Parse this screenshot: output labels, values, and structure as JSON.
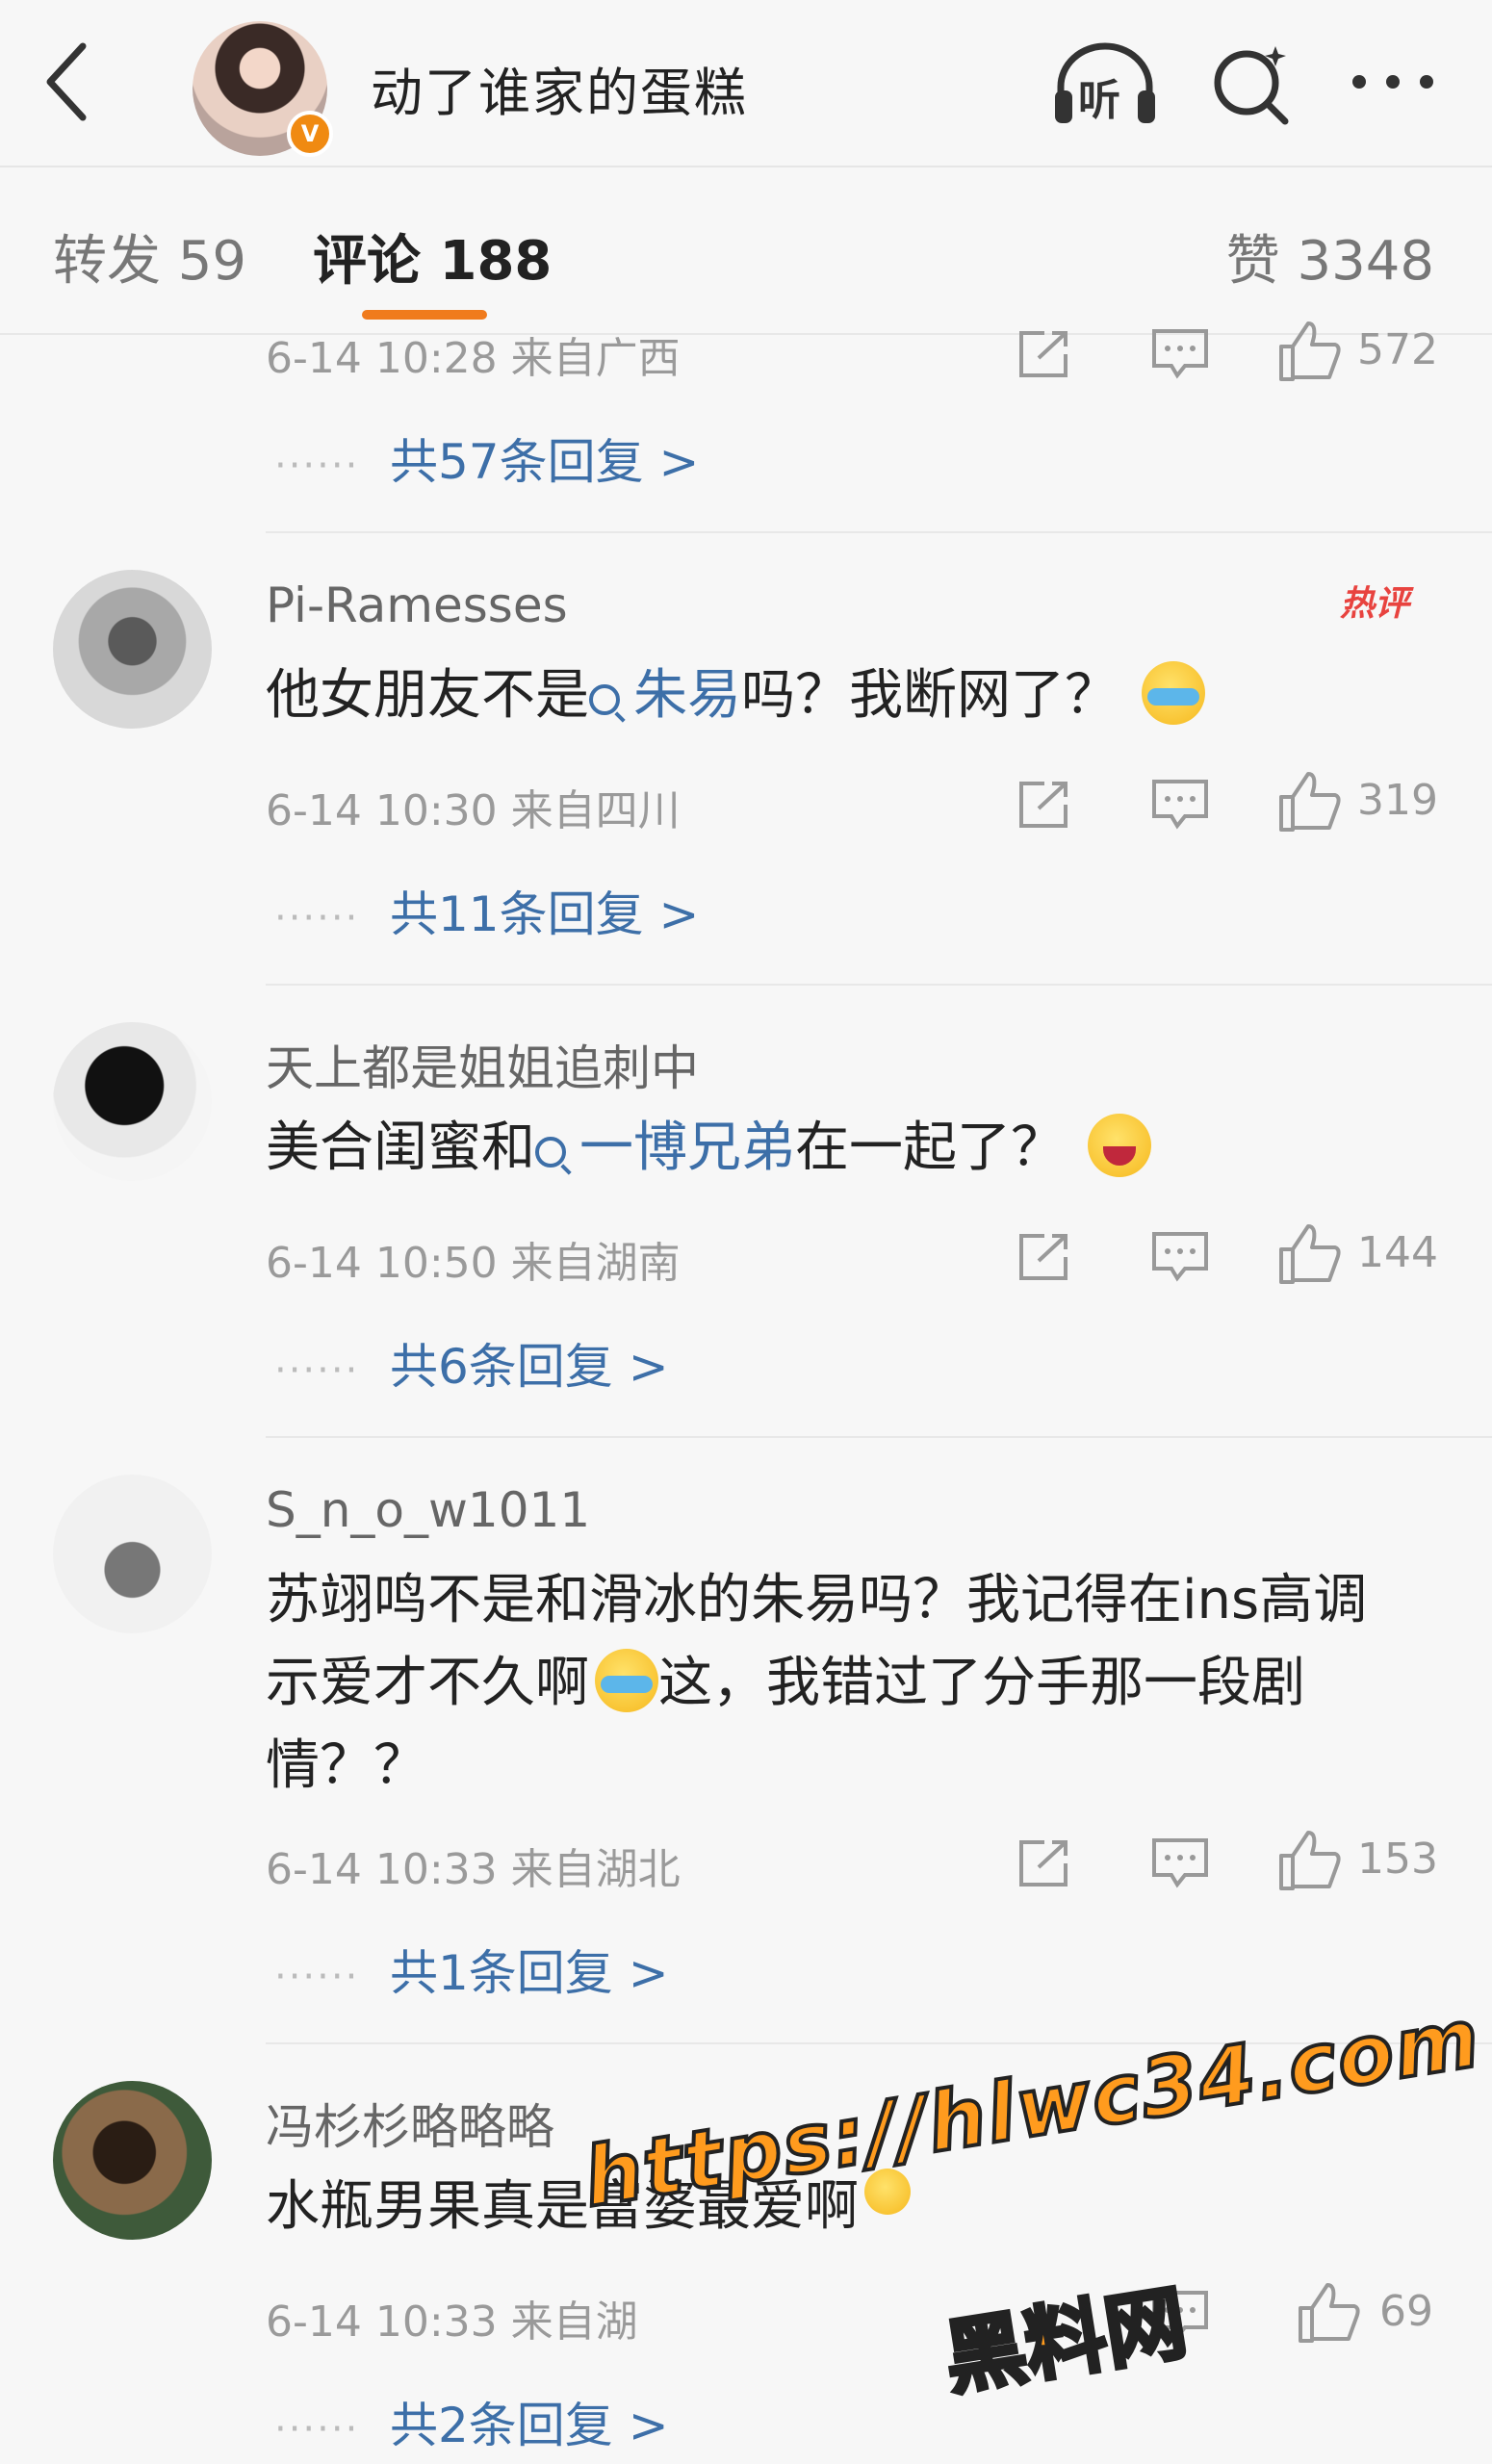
{
  "header": {
    "title": "动了谁家的蛋糕",
    "listen_label": "听",
    "badge": "V"
  },
  "tabs": {
    "repost": "转发 59",
    "comments": "评论 188",
    "likes": "赞 3348"
  },
  "top_partial": {
    "meta": "6-14 10:28 来自广西",
    "likes": "572",
    "replies": "共57条回复 >"
  },
  "comments": [
    {
      "username": "Pi-Ramesses",
      "badge": "热评",
      "text_before": "他女朋友不是",
      "topic": "朱易",
      "text_after": "吗？我断网了？",
      "meta": "6-14 10:30 来自四川",
      "likes": "319",
      "replies": "共11条回复 >"
    },
    {
      "username": "天上都是姐姐追刺中",
      "text_before": "美合闺蜜和",
      "topic": "一博兄弟",
      "text_after": "在一起了？",
      "meta": "6-14 10:50 来自湖南",
      "likes": "144",
      "replies": "共6条回复 >"
    },
    {
      "username": "S_n_o_w1011",
      "text_line1": "苏翊鸣不是和滑冰的朱易吗？我记得在ins高调",
      "text_line2a": "示爱才不久啊",
      "text_line2b": "这，我错过了分手那一段剧",
      "text_line3": "情？？",
      "meta": "6-14 10:33 来自湖北",
      "likes": "153",
      "replies": "共1条回复 >"
    },
    {
      "username": "冯杉杉略略略",
      "text": "水瓶男果真是富婆最爱啊",
      "meta": "6-14 10:33 来自湖",
      "likes": "69",
      "replies": "共2条回复 >"
    }
  ],
  "reply_dots": "······",
  "watermark": {
    "url": "https://hlwc34.com",
    "name": "黑料网"
  },
  "colors": {
    "accent": "#f07b1d",
    "link": "#3d6fa8",
    "hot": "#e8433f"
  }
}
